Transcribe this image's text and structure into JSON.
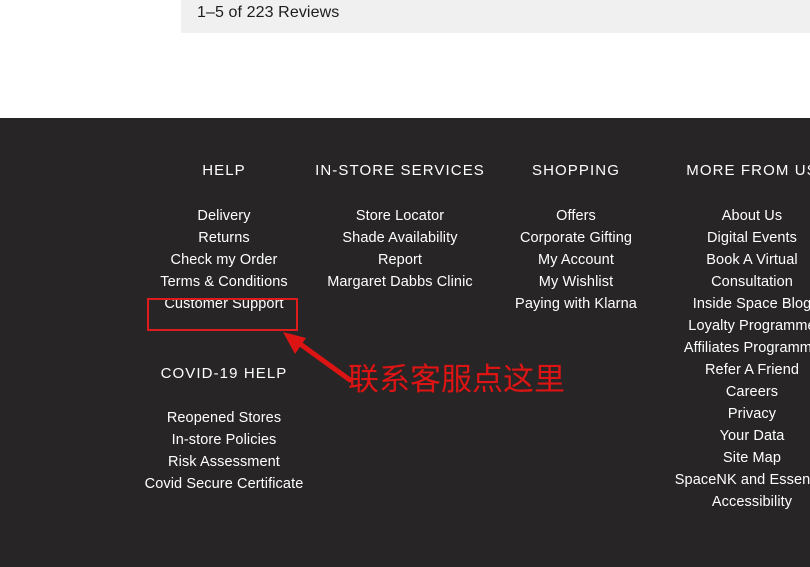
{
  "reviews": {
    "summary": "1–5 of 223 Reviews"
  },
  "footer": {
    "columns": [
      {
        "title": "HELP",
        "links": [
          "Delivery",
          "Returns",
          "Check my Order",
          "Terms & Conditions",
          "Customer Support"
        ]
      },
      {
        "title": "IN-STORE SERVICES",
        "links": [
          "Store Locator",
          "Shade Availability",
          "Report",
          "Margaret Dabbs Clinic"
        ]
      },
      {
        "title": "SHOPPING",
        "links": [
          "Offers",
          "Corporate Gifting",
          "My Account",
          "My Wishlist",
          "Paying with Klarna"
        ]
      },
      {
        "title": "MORE FROM US",
        "links": [
          "About Us",
          "Digital Events",
          "Book A Virtual",
          "Consultation",
          "Inside Space Blog",
          "Loyalty Programme",
          "Affiliates Programme",
          "Refer A Friend",
          "Careers",
          "Privacy",
          "Your Data",
          "Site Map",
          "SpaceNK and Essential",
          "Accessibility"
        ]
      }
    ],
    "covid": {
      "title": "COVID-19 HELP",
      "links": [
        "Reopened Stores",
        "In-store Policies",
        "Risk Assessment",
        "Covid Secure Certificate"
      ]
    }
  },
  "annotation": {
    "text": "联系客服点这里",
    "color": "#dd1414",
    "highlight_target": "Customer Support"
  }
}
